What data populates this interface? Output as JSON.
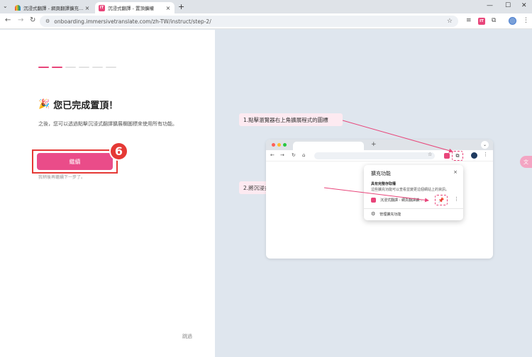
{
  "browser": {
    "tabs": [
      {
        "title": "沉浸式翻譯 - 網頁翻譯擴充 | PDF",
        "active": false,
        "favicon": "rainbow-icon"
      },
      {
        "title": "沉浸式翻譯 - 置頂擴權",
        "active": true,
        "favicon": "it-logo-icon"
      }
    ],
    "url": "onboarding.immersivetranslate.com/zh-TW/instruct/step-2/"
  },
  "left": {
    "progress": {
      "steps": 6,
      "completed": 2
    },
    "title": "您已完成置頂！",
    "description": "之後，您可以透過點擊沉浸式翻譯擴展欄圖標來使用所有功能。",
    "continue_label": "繼續",
    "later_link": "我稍後再繼續下一步了。",
    "step_badge": "6",
    "skip_label": "跳過"
  },
  "illustration": {
    "callout1": "1.點擊瀏覽器右上角擴展程式的圖標",
    "callout2": "2.將沉浸式翻譯固定到工具欄",
    "popup": {
      "title": "擴充功能",
      "subtitle": "具有完整存取權",
      "note": "這些擴充功能可以查看並變更這個網站上的資訊。",
      "extension_name": "沉浸式翻譯 - 網頁翻譯擴...",
      "manage_label": "管理擴充功能"
    }
  },
  "colors": {
    "accent": "#ea4c89",
    "highlight_red": "#e53935",
    "right_bg": "#dfe6ee"
  }
}
